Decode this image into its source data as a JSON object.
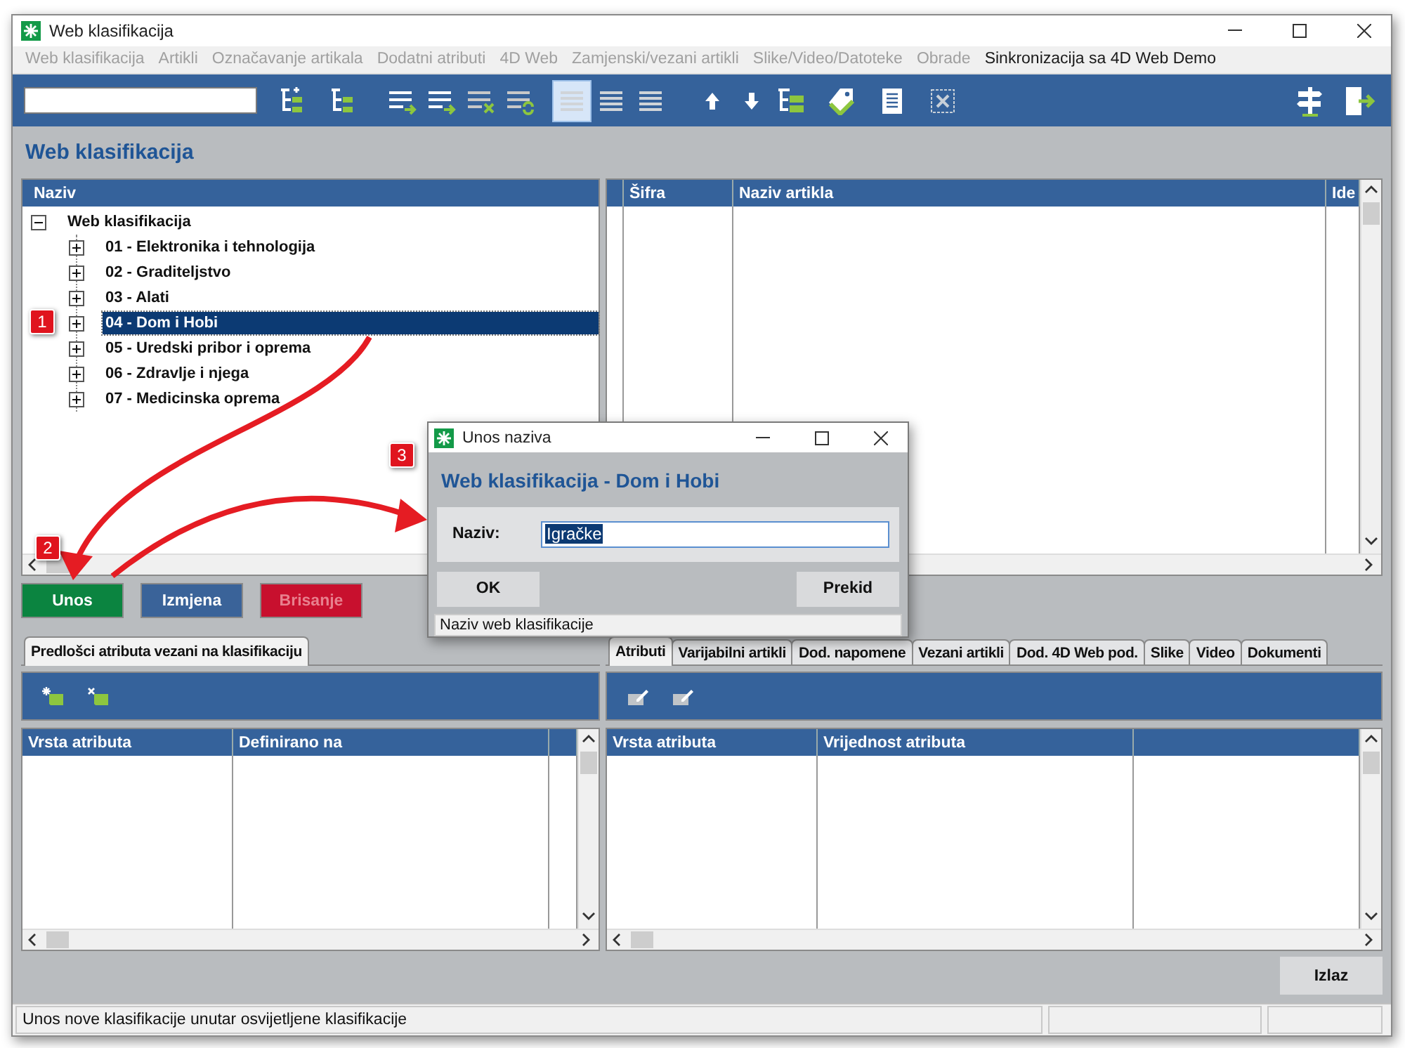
{
  "window": {
    "title": "Web klasifikacija"
  },
  "menu": [
    {
      "label": "Web klasifikacija",
      "disabled": true
    },
    {
      "label": "Artikli",
      "disabled": true
    },
    {
      "label": "Označavanje artikala",
      "disabled": true
    },
    {
      "label": "Dodatni atributi",
      "disabled": true
    },
    {
      "label": "4D Web",
      "disabled": true
    },
    {
      "label": "Zamjenski/vezani artikli",
      "disabled": true
    },
    {
      "label": "Slike/Video/Datoteke",
      "disabled": true
    },
    {
      "label": "Obrade",
      "disabled": true
    },
    {
      "label": "Sinkronizacija sa 4D Web Demo",
      "disabled": false
    }
  ],
  "toolbar": {
    "view_modes": [
      {
        "selected": true
      },
      {
        "selected": false
      },
      {
        "selected": false
      }
    ]
  },
  "heading": "Web klasifikacija",
  "tree": {
    "column": "Naziv",
    "items": [
      {
        "label": "Web klasifikacija",
        "expanded": true,
        "selected": false,
        "children": [
          {
            "label": "01 - Elektronika i tehnologija",
            "expanded": false,
            "selected": false
          },
          {
            "label": "02 - Graditeljstvo",
            "expanded": false,
            "selected": false
          },
          {
            "label": "03 - Alati",
            "expanded": false,
            "selected": false
          },
          {
            "label": "04 - Dom i Hobi",
            "expanded": false,
            "selected": true
          },
          {
            "label": "05 - Uredski pribor i oprema",
            "expanded": false,
            "selected": false
          },
          {
            "label": "06 - Zdravlje i njega",
            "expanded": false,
            "selected": false
          },
          {
            "label": "07 - Medicinska oprema",
            "expanded": false,
            "selected": false
          }
        ]
      }
    ]
  },
  "articles_table": {
    "columns": [
      "Šifra",
      "Naziv artikla",
      "Ide"
    ]
  },
  "actions": [
    {
      "label": "Unos",
      "kind": "add",
      "disabled": false
    },
    {
      "label": "Izmjena",
      "kind": "edit",
      "disabled": false
    },
    {
      "label": "Brisanje",
      "kind": "delete",
      "disabled": true
    }
  ],
  "templates_panel": {
    "tabs": [
      {
        "label": "Predlošci atributa vezani na klasifikaciju",
        "selected": true
      }
    ],
    "tools_disabled": false,
    "columns": [
      "Vrsta atributa",
      "Definirano na"
    ]
  },
  "details_panel": {
    "tabs": [
      {
        "label": "Atributi",
        "selected": true
      },
      {
        "label": "Varijabilni artikli",
        "selected": false
      },
      {
        "label": "Dod. napomene",
        "selected": false
      },
      {
        "label": "Vezani artikli",
        "selected": false
      },
      {
        "label": "Dod. 4D Web pod.",
        "selected": false
      },
      {
        "label": "Slike",
        "selected": false
      },
      {
        "label": "Video",
        "selected": false
      },
      {
        "label": "Dokumenti",
        "selected": false
      }
    ],
    "tools_disabled": true,
    "columns": [
      "Vrsta atributa",
      "Vrijednost atributa"
    ]
  },
  "exit_button": "Izlaz",
  "status_bar": "Unos nove klasifikacije unutar osvijetljene klasifikacije",
  "dialog": {
    "title": "Unos naziva",
    "heading": "Web klasifikacija - Dom i Hobi",
    "field_label": "Naziv:",
    "field_value": "Igračke",
    "buttons": [
      "OK",
      "Prekid"
    ],
    "status": "Naziv web klasifikacije"
  },
  "annotations": [
    "1",
    "2",
    "3"
  ]
}
